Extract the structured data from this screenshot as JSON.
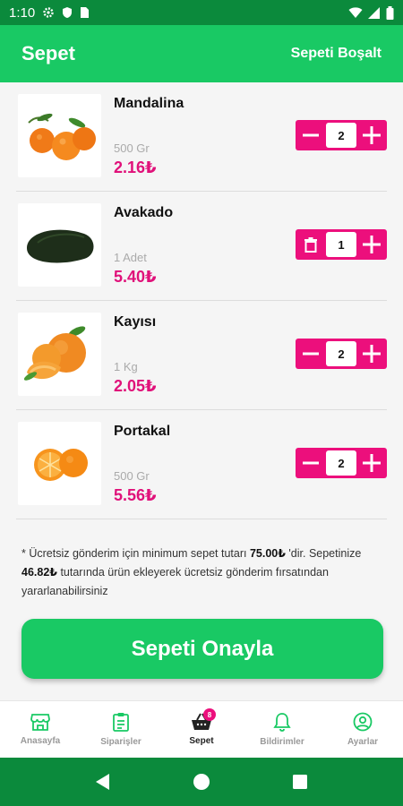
{
  "status_bar": {
    "time": "1:10"
  },
  "header": {
    "title": "Sepet",
    "action_label": "Sepeti Boşalt"
  },
  "items": [
    {
      "name": "Mandalina",
      "unit": "500 Gr",
      "price": "2.16₺",
      "quantity": "2",
      "decrement_icon": "minus-icon",
      "image_icon": "tangerines"
    },
    {
      "name": "Avakado",
      "unit": "1 Adet",
      "price": "5.40₺",
      "quantity": "1",
      "decrement_icon": "trash-icon",
      "image_icon": "avocado"
    },
    {
      "name": "Kayısı",
      "unit": "1 Kg",
      "price": "2.05₺",
      "quantity": "2",
      "decrement_icon": "minus-icon",
      "image_icon": "apricots"
    },
    {
      "name": "Portakal",
      "unit": "500 Gr",
      "price": "5.56₺",
      "quantity": "2",
      "decrement_icon": "minus-icon",
      "image_icon": "oranges"
    }
  ],
  "notice": {
    "prefix": "* Ücretsiz gönderim için minimum sepet tutarı ",
    "min_amount": "75.00₺",
    "middle": " 'dir. Sepetinize ",
    "remaining_amount": "46.82₺",
    "suffix": " tutarında ürün ekleyerek ücretsiz gönderim fırsatından yararlanabilirsiniz"
  },
  "confirm_label": "Sepeti Onayla",
  "bottom_nav": [
    {
      "label": "Anasayfa",
      "icon": "store-icon"
    },
    {
      "label": "Siparişler",
      "icon": "clipboard-icon"
    },
    {
      "label": "Sepet",
      "icon": "basket-icon",
      "badge": "8",
      "active": true
    },
    {
      "label": "Bildirimler",
      "icon": "bell-icon"
    },
    {
      "label": "Ayarlar",
      "icon": "user-circle-icon"
    }
  ],
  "colors": {
    "primary_green": "#19c964",
    "dark_green": "#0b8a3c",
    "accent_pink": "#ec0f7c"
  }
}
